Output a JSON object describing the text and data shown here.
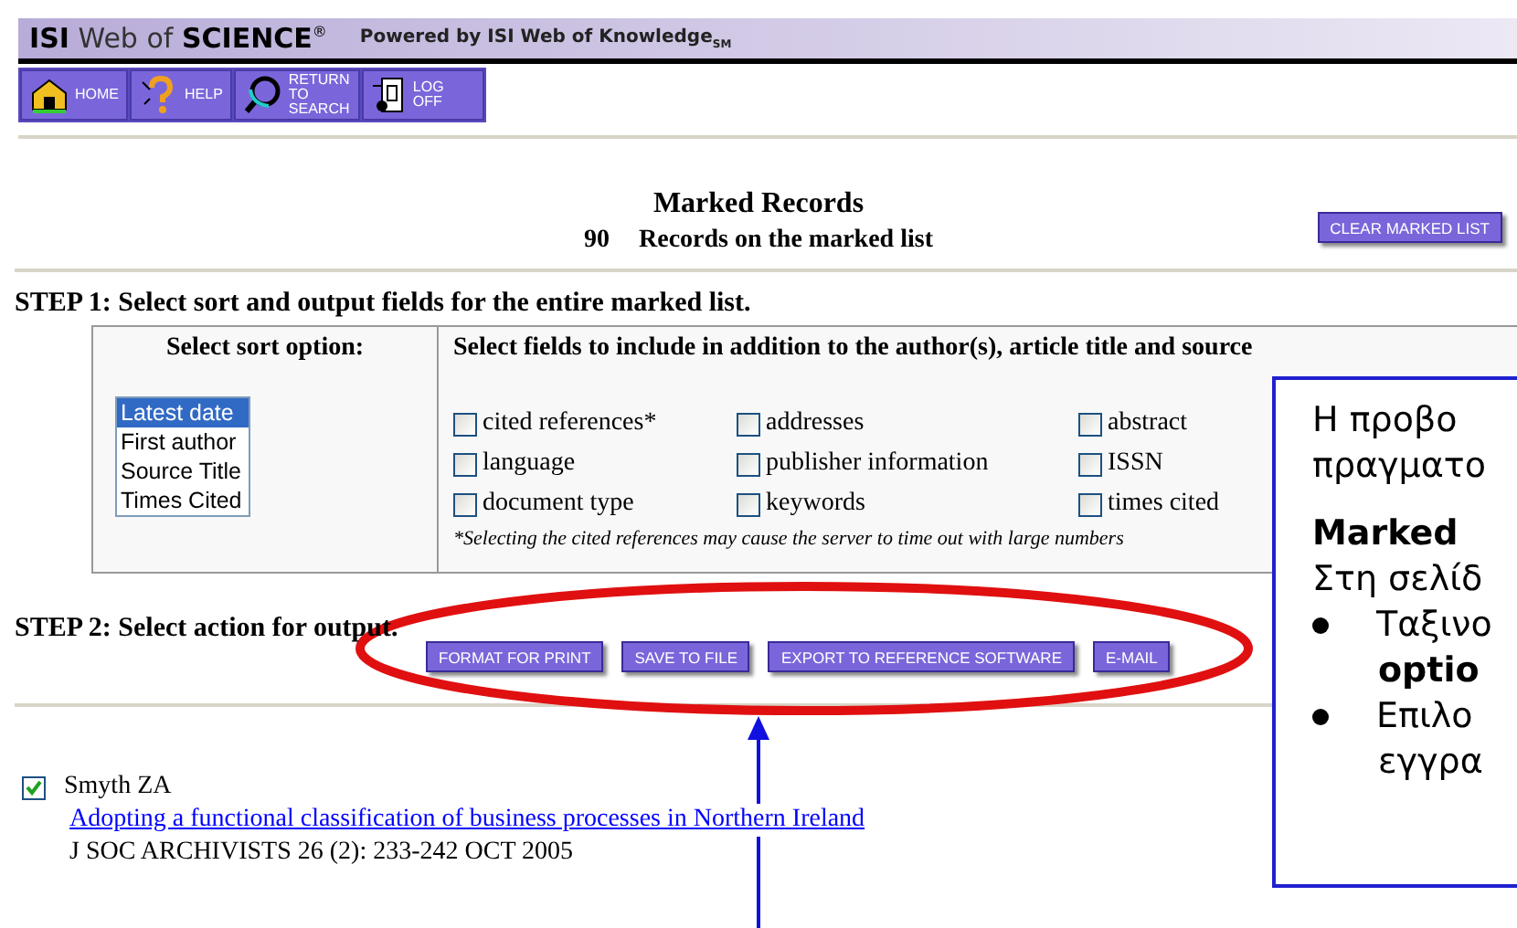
{
  "banner": {
    "brand_light": "ISI",
    "brand_mid": "Web of",
    "brand_bold": "SCIENCE",
    "registered": "®",
    "powered": "Powered by ISI Web of Knowledge$_{SM}$"
  },
  "nav": [
    {
      "label": "HOME",
      "kind": "home"
    },
    {
      "label": "HELP",
      "kind": "help"
    },
    {
      "label": "RETURN TO SEARCH",
      "kind": "search"
    },
    {
      "label": "LOG OFF",
      "kind": "logoff"
    }
  ],
  "marked": {
    "title": "Marked Records",
    "count": "90",
    "caption": "Records on the marked list",
    "clear_button": "CLEAR MARKED LIST"
  },
  "step1": {
    "heading": "STEP 1: Select sort and output fields for the entire marked list.",
    "sort_heading": "Select sort option:",
    "fields_heading": "Select fields to include in addition to the author(s), article title and source",
    "sort_options": [
      {
        "label": "Latest date",
        "selected": true
      },
      {
        "label": "First author",
        "selected": false
      },
      {
        "label": "Source Title",
        "selected": false
      },
      {
        "label": "Times Cited",
        "selected": false
      }
    ],
    "fields": [
      {
        "label": "cited references*",
        "checked": false
      },
      {
        "label": "addresses",
        "checked": false
      },
      {
        "label": "abstract",
        "checked": false
      },
      {
        "label": "language",
        "checked": false
      },
      {
        "label": "publisher information",
        "checked": false
      },
      {
        "label": "ISSN",
        "checked": false
      },
      {
        "label": "document type",
        "checked": false
      },
      {
        "label": "keywords",
        "checked": false
      },
      {
        "label": "times cited",
        "checked": false
      }
    ],
    "footnote": "*Selecting the cited references may cause the server to time out with large numbers"
  },
  "step2": {
    "heading": "STEP 2: Select action for output.",
    "buttons": [
      "FORMAT FOR PRINT",
      "SAVE TO FILE",
      "EXPORT TO REFERENCE SOFTWARE",
      "E-MAIL"
    ]
  },
  "records": [
    {
      "checked": true,
      "authors": "Smyth ZA",
      "title": "Adopting a functional classification of business processes in Northern Ireland",
      "source": "J SOC ARCHIVISTS 26 (2): 233-242 OCT 2005"
    }
  ],
  "callout": [
    {
      "text": "Η προβο",
      "kind": "plain",
      "bold": false
    },
    {
      "text": "πραγματο",
      "kind": "plain",
      "bold": false
    },
    {
      "text": "Marked",
      "kind": "heading",
      "bold": true
    },
    {
      "text": "Στη σελίδ",
      "kind": "plain",
      "bold": false
    },
    {
      "text": "Ταξινο",
      "kind": "bullet",
      "bold": false
    },
    {
      "text": "optio",
      "kind": "continuation",
      "bold": true
    },
    {
      "text": "Επιλο",
      "kind": "bullet",
      "bold": false
    },
    {
      "text": "εγγρα",
      "kind": "continuation",
      "bold": false
    }
  ]
}
